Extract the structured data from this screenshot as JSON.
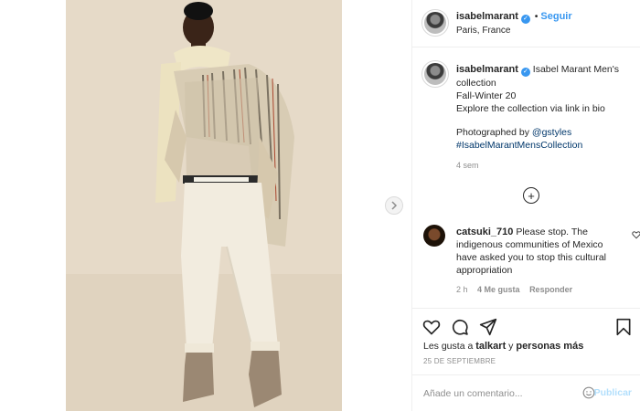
{
  "post": {
    "username": "isabelmarant",
    "follow_label": "Seguir",
    "location": "Paris, France",
    "caption_title": "Isabel Marant Men's collection",
    "caption_lines": [
      "Fall-Winter 20",
      "Explore the collection via link in bio"
    ],
    "photo_credit_prefix": "Photographed by ",
    "photo_credit_handle": "@gstyles",
    "hashtag": "#IsabelMarantMensCollection",
    "age": "4 sem"
  },
  "comment": {
    "username": "catsuki_710",
    "text": "Please stop. The indigenous communities of Mexico have asked you to stop this cultural appropriation",
    "age": "2 h",
    "likes": "4 Me gusta",
    "reply_label": "Responder"
  },
  "engagement": {
    "likes_prefix": "Les gusta a ",
    "likes_user": "talkart",
    "likes_mid": " y ",
    "likes_others": "personas más",
    "date": "25 DE SEPTIEMBRE"
  },
  "composer": {
    "placeholder": "Añade un comentario...",
    "publish_label": "Publicar"
  },
  "colors": {
    "accent": "#3897f0",
    "link": "#00376b",
    "muted": "#8e8e8e",
    "publish_disabled": "#b2dffc"
  },
  "icons": {
    "verified": "verified-badge-icon",
    "next": "chevron-right-icon",
    "add": "plus-circle-icon",
    "like": "heart-icon",
    "comment": "comment-bubble-icon",
    "share": "paper-plane-icon",
    "save": "bookmark-icon",
    "emoji": "smiley-icon"
  }
}
